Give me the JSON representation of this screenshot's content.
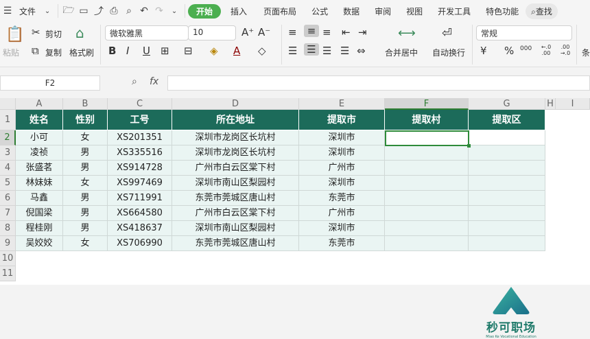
{
  "menu": {
    "file": "文件",
    "tabs": [
      "开始",
      "插入",
      "页面布局",
      "公式",
      "数据",
      "审阅",
      "视图",
      "开发工具",
      "特色功能"
    ],
    "search": "查找"
  },
  "ribbon": {
    "paste": "粘贴",
    "cut": "剪切",
    "copy": "复制",
    "format_painter": "格式刷",
    "font": "微软雅黑",
    "font_size": "10",
    "merge": "合并居中",
    "wrap": "自动换行",
    "number_format": "常规",
    "currency": "¥",
    "percent": "%",
    "thousands": "000",
    "inc_decimal": "←.0 .00",
    "dec_decimal": ".00 →.0",
    "cond": "条"
  },
  "formula_bar": {
    "name_box": "F2",
    "fx": "fx",
    "value": ""
  },
  "columns": [
    "A",
    "B",
    "C",
    "D",
    "E",
    "F",
    "G",
    "H",
    "I"
  ],
  "rows": [
    "1",
    "2",
    "3",
    "4",
    "5",
    "6",
    "7",
    "8",
    "9",
    "10",
    "11"
  ],
  "headers": [
    "姓名",
    "性别",
    "工号",
    "所在地址",
    "提取市",
    "提取村",
    "提取区"
  ],
  "data": [
    [
      "小可",
      "女",
      "XS201351",
      "深圳市龙岗区长坑村",
      "深圳市",
      "",
      ""
    ],
    [
      "凌祯",
      "男",
      "XS335516",
      "深圳市龙岗区长坑村",
      "深圳市",
      "",
      ""
    ],
    [
      "张盛茗",
      "男",
      "XS914728",
      "广州市白云区棠下村",
      "广州市",
      "",
      ""
    ],
    [
      "林妹妹",
      "女",
      "XS997469",
      "深圳市南山区梨园村",
      "深圳市",
      "",
      ""
    ],
    [
      "马鑫",
      "男",
      "XS711991",
      "东莞市莞城区唐山村",
      "东莞市",
      "",
      ""
    ],
    [
      "倪国梁",
      "男",
      "XS664580",
      "广州市白云区棠下村",
      "广州市",
      "",
      ""
    ],
    [
      "程桂刚",
      "男",
      "XS418637",
      "深圳市南山区梨园村",
      "深圳市",
      "",
      ""
    ],
    [
      "吴姣姣",
      "女",
      "XS706990",
      "东莞市莞城区唐山村",
      "东莞市",
      "",
      ""
    ]
  ],
  "logo": {
    "name": "秒可职场",
    "subtitle": "Miao Ke Vocational Education"
  },
  "colors": {
    "header_bg": "#1c6b5a",
    "accent": "#4caf50",
    "body_bg": "#eaf5f3"
  }
}
